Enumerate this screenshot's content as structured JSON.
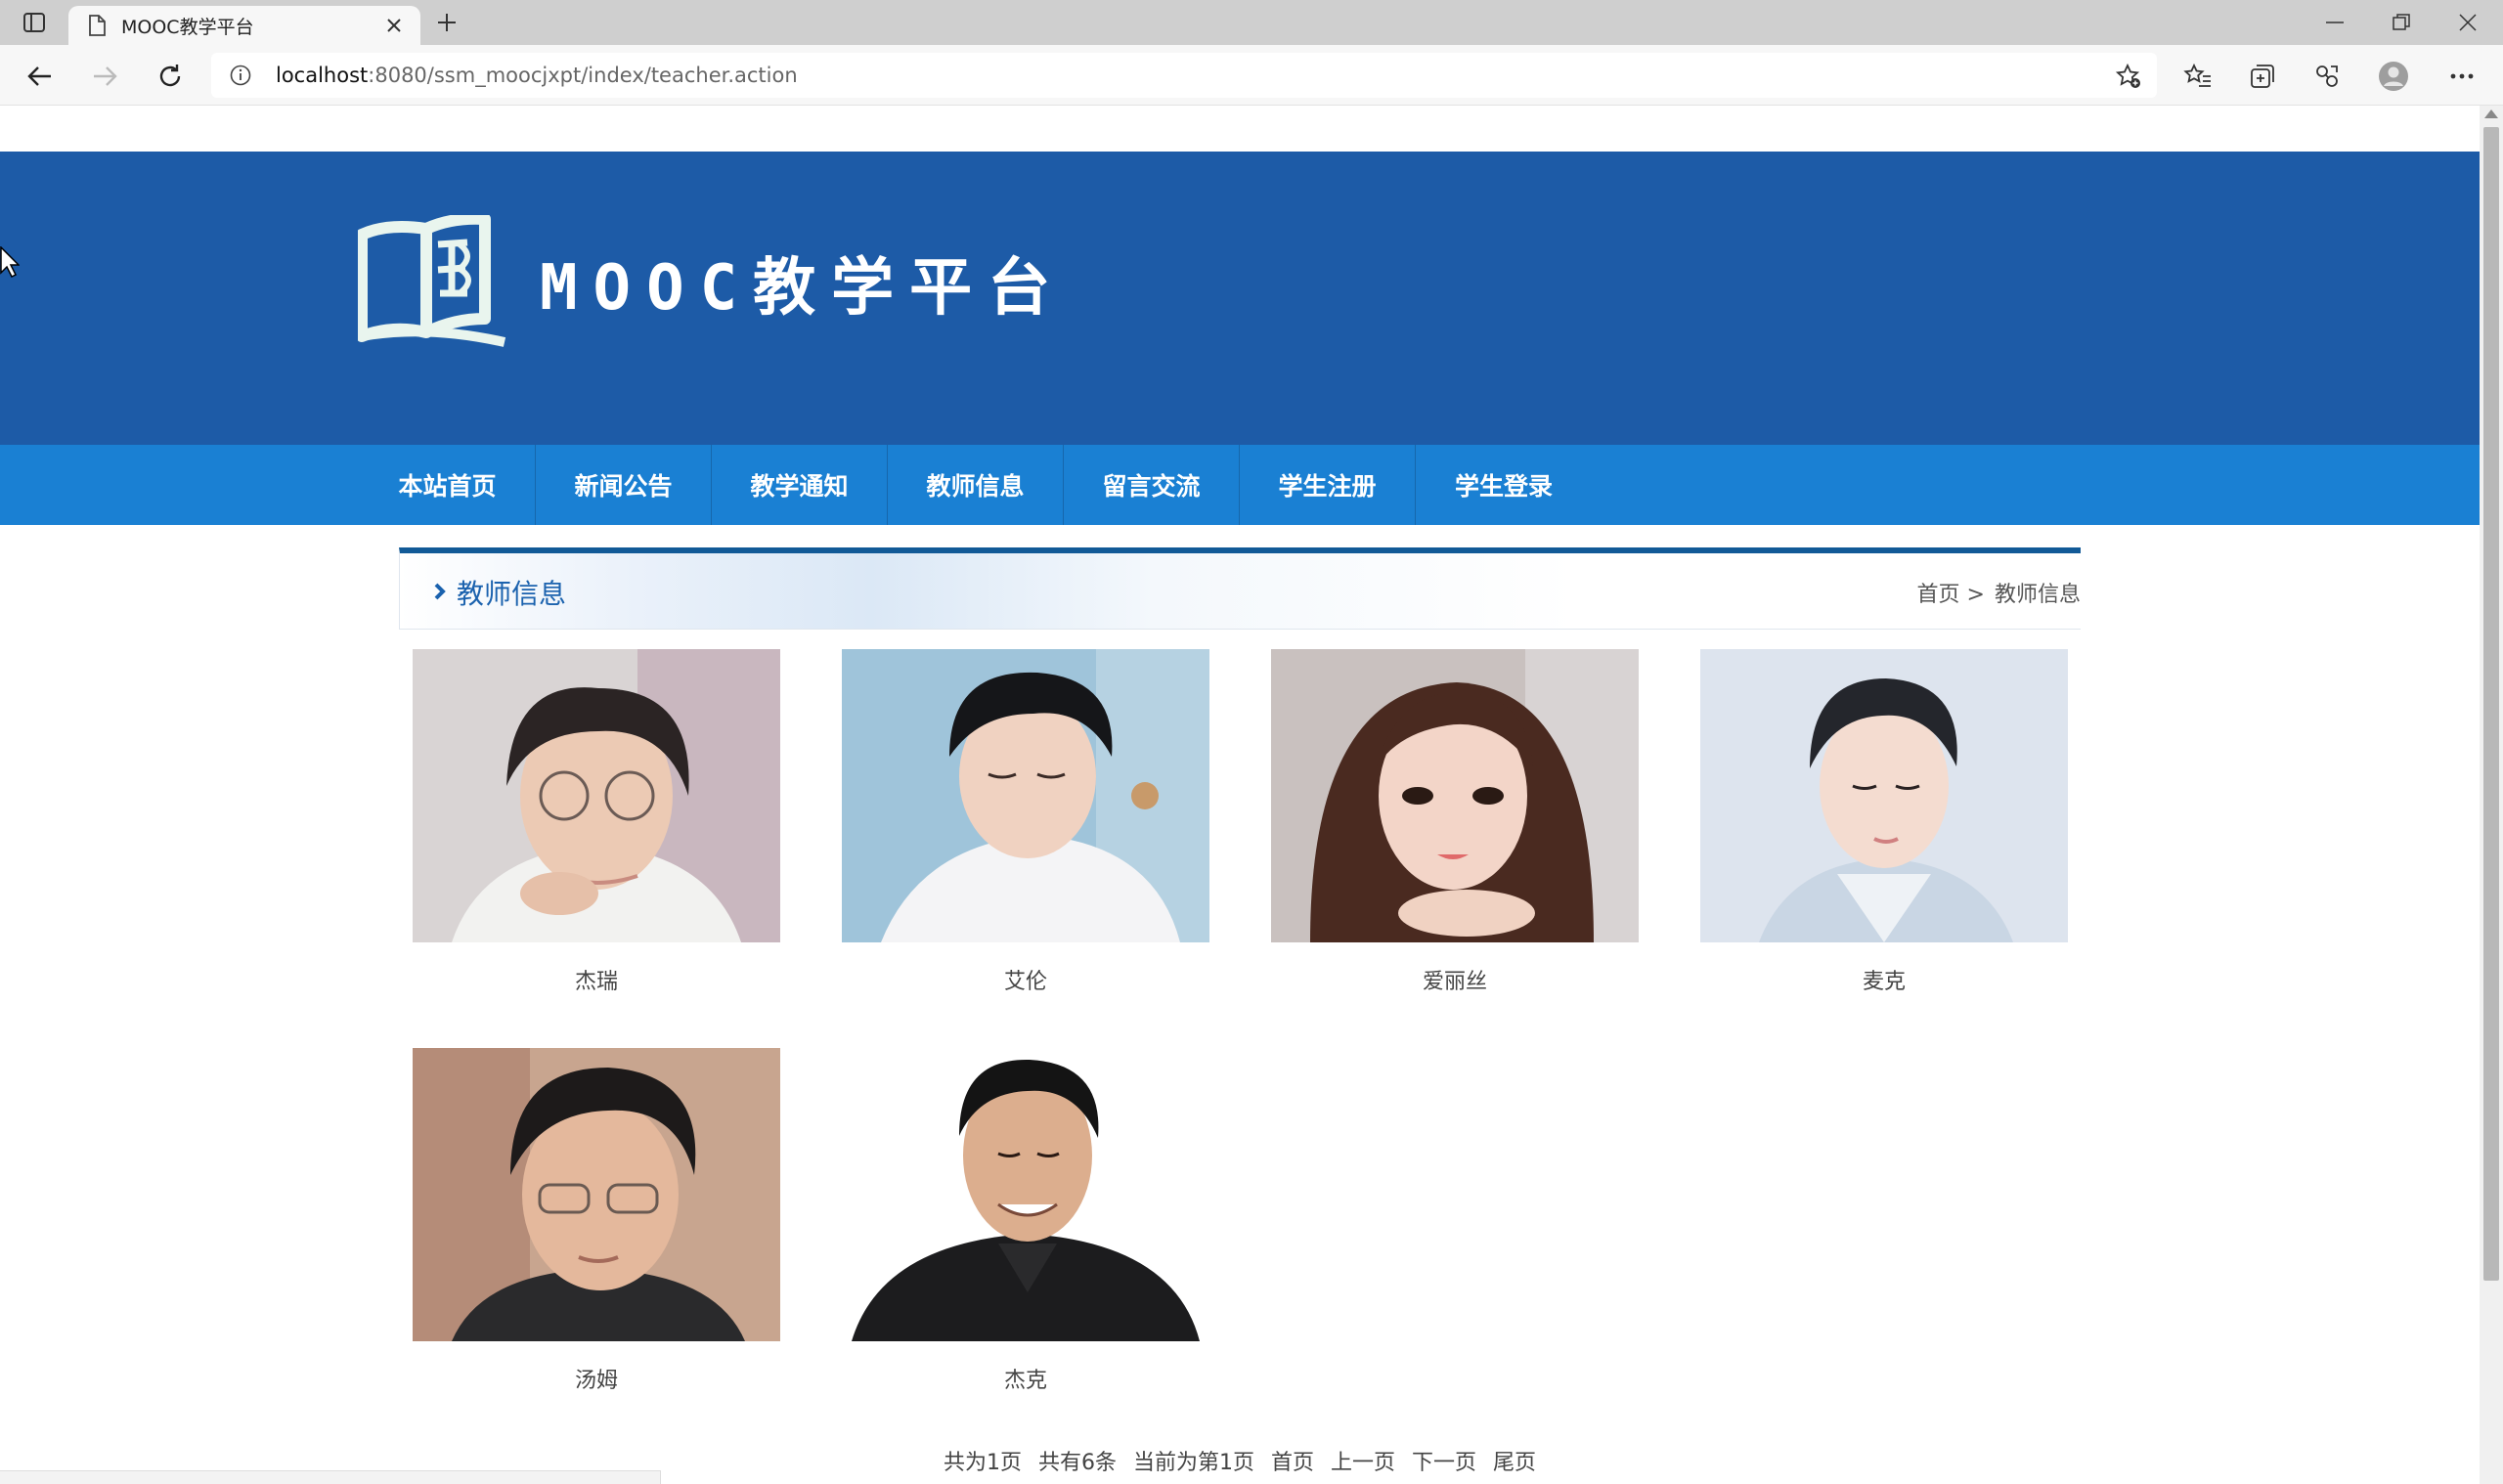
{
  "browser": {
    "tab_title": "MOOC教学平台",
    "url_host": "localhost",
    "url_path": ":8080/ssm_moocjxpt/index/teacher.action"
  },
  "site": {
    "title": "MOOC教学平台",
    "header_bg": "#1d5ba7",
    "nav_bg": "#1a80d3"
  },
  "nav": [
    {
      "label": "本站首页"
    },
    {
      "label": "新闻公告"
    },
    {
      "label": "教学通知"
    },
    {
      "label": "教师信息"
    },
    {
      "label": "留言交流"
    },
    {
      "label": "学生注册"
    },
    {
      "label": "学生登录"
    }
  ],
  "section": {
    "title": "教师信息",
    "breadcrumb_home": "首页 >",
    "breadcrumb_current": "教师信息"
  },
  "teachers": [
    {
      "name": "杰瑞"
    },
    {
      "name": "艾伦"
    },
    {
      "name": "爱丽丝"
    },
    {
      "name": "麦克"
    },
    {
      "name": "汤姆"
    },
    {
      "name": "杰克"
    }
  ],
  "pager": {
    "total_pages": "共为1页",
    "total_records": "共有6条",
    "current": "当前为第1页",
    "first": "首页",
    "prev": "上一页",
    "next": "下一页",
    "last": "尾页"
  }
}
